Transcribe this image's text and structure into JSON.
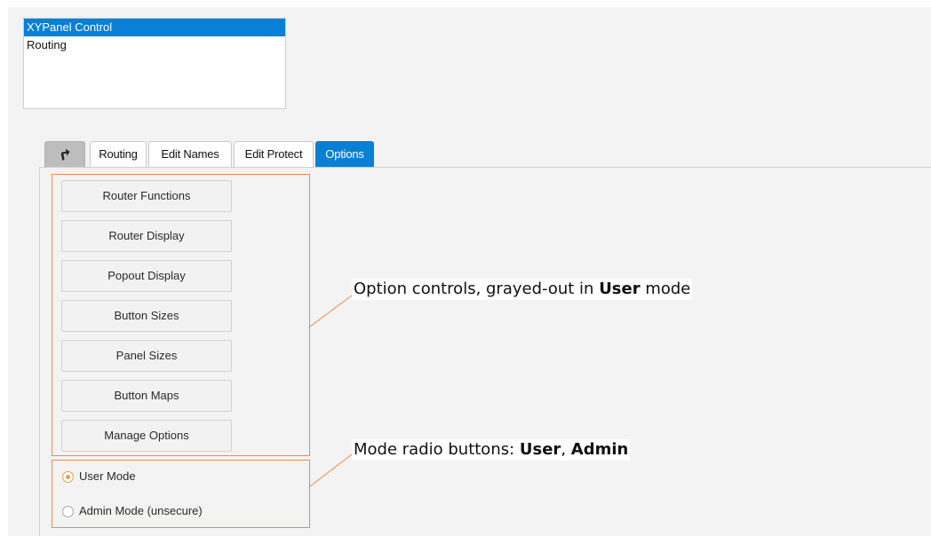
{
  "panel_list": {
    "items": [
      {
        "label": "XYPanel Control",
        "selected": true
      },
      {
        "label": "Routing",
        "selected": false
      }
    ]
  },
  "tabs": {
    "icon": "pointer-arrow-icon",
    "items": [
      {
        "label": "Routing",
        "active": false
      },
      {
        "label": "Edit Names",
        "active": false
      },
      {
        "label": "Edit Protect",
        "active": false
      },
      {
        "label": "Options",
        "active": true
      }
    ]
  },
  "options": {
    "buttons": [
      "Router Functions",
      "Router Display",
      "Popout Display",
      "Button Sizes",
      "Panel Sizes",
      "Button Maps",
      "Manage Options"
    ]
  },
  "mode": {
    "selected": "User Mode",
    "radios": [
      {
        "label": "User Mode",
        "checked": true
      },
      {
        "label": "Admin Mode (unsecure)",
        "checked": false
      }
    ]
  },
  "callouts": {
    "options": {
      "prefix": "Option controls, grayed-out in ",
      "bold": "User",
      "suffix": " mode"
    },
    "mode": {
      "prefix": "Mode radio buttons: ",
      "bold1": "User",
      "sep": ", ",
      "bold2": "Admin"
    }
  },
  "colors": {
    "selection": "#0a7fd6",
    "annotation": "#f08a4b",
    "radio_accent": "#e0a050"
  }
}
